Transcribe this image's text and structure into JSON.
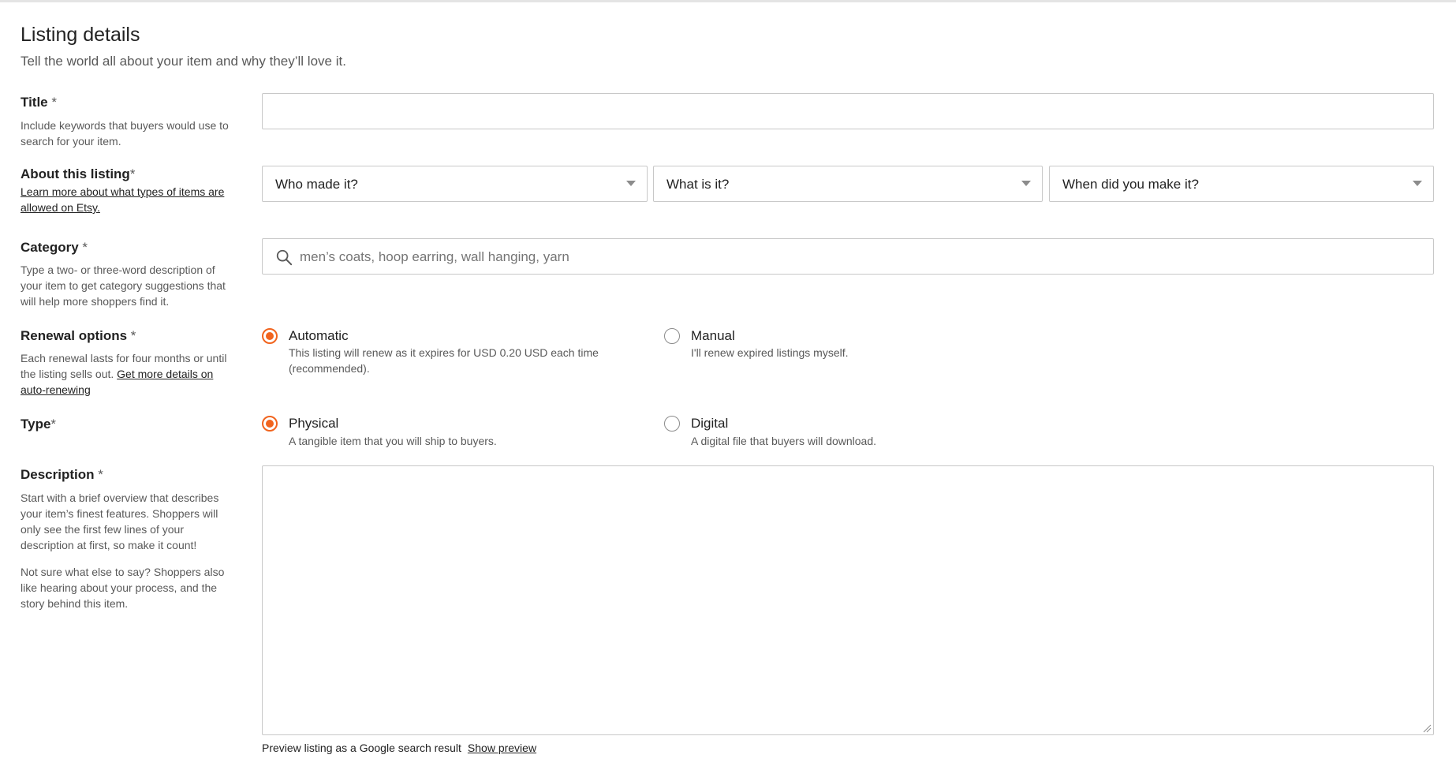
{
  "header": {
    "title": "Listing details",
    "subtitle": "Tell the world all about your item and why they’ll love it."
  },
  "title_field": {
    "label": "Title",
    "required_mark": " *",
    "help": "Include keywords that buyers would use to search for your item.",
    "value": ""
  },
  "about": {
    "label": "About this listing",
    "required_mark": "*",
    "help_link": "Learn more about what types of items are allowed on Etsy.",
    "selects": [
      {
        "label": "Who made it?"
      },
      {
        "label": "What is it?"
      },
      {
        "label": "When did you make it?"
      }
    ]
  },
  "category": {
    "label": "Category",
    "required_mark": " *",
    "help": "Type a two- or three-word description of your item to get category suggestions that will help more shoppers find it.",
    "placeholder": "men’s coats, hoop earring, wall hanging, yarn",
    "icon": "search-icon"
  },
  "renewal": {
    "label": "Renewal options",
    "required_mark": " *",
    "help_text": "Each renewal lasts for four months or until the listing sells out. ",
    "help_link": "Get more details on auto-renewing",
    "options": [
      {
        "label": "Automatic",
        "description": "This listing will renew as it expires for USD 0.20 USD each time (recommended).",
        "selected": true
      },
      {
        "label": "Manual",
        "description": "I'll renew expired listings myself.",
        "selected": false
      }
    ]
  },
  "type": {
    "label": "Type",
    "required_mark": "*",
    "options": [
      {
        "label": "Physical",
        "description": "A tangible item that you will ship to buyers.",
        "selected": true
      },
      {
        "label": "Digital",
        "description": "A digital file that buyers will download.",
        "selected": false
      }
    ]
  },
  "description": {
    "label": "Description",
    "required_mark": " *",
    "help_1": "Start with a brief overview that describes your item’s finest features. Shoppers will only see the first few lines of your description at first, so make it count!",
    "help_2": "Not sure what else to say? Shoppers also like hearing about your process, and the story behind this item.",
    "value": ""
  },
  "preview": {
    "text": "Preview listing as a Google search result",
    "link": "Show preview"
  },
  "colors": {
    "accent": "#f1641e",
    "border": "#c8c8c8",
    "muted_text": "#595959"
  }
}
